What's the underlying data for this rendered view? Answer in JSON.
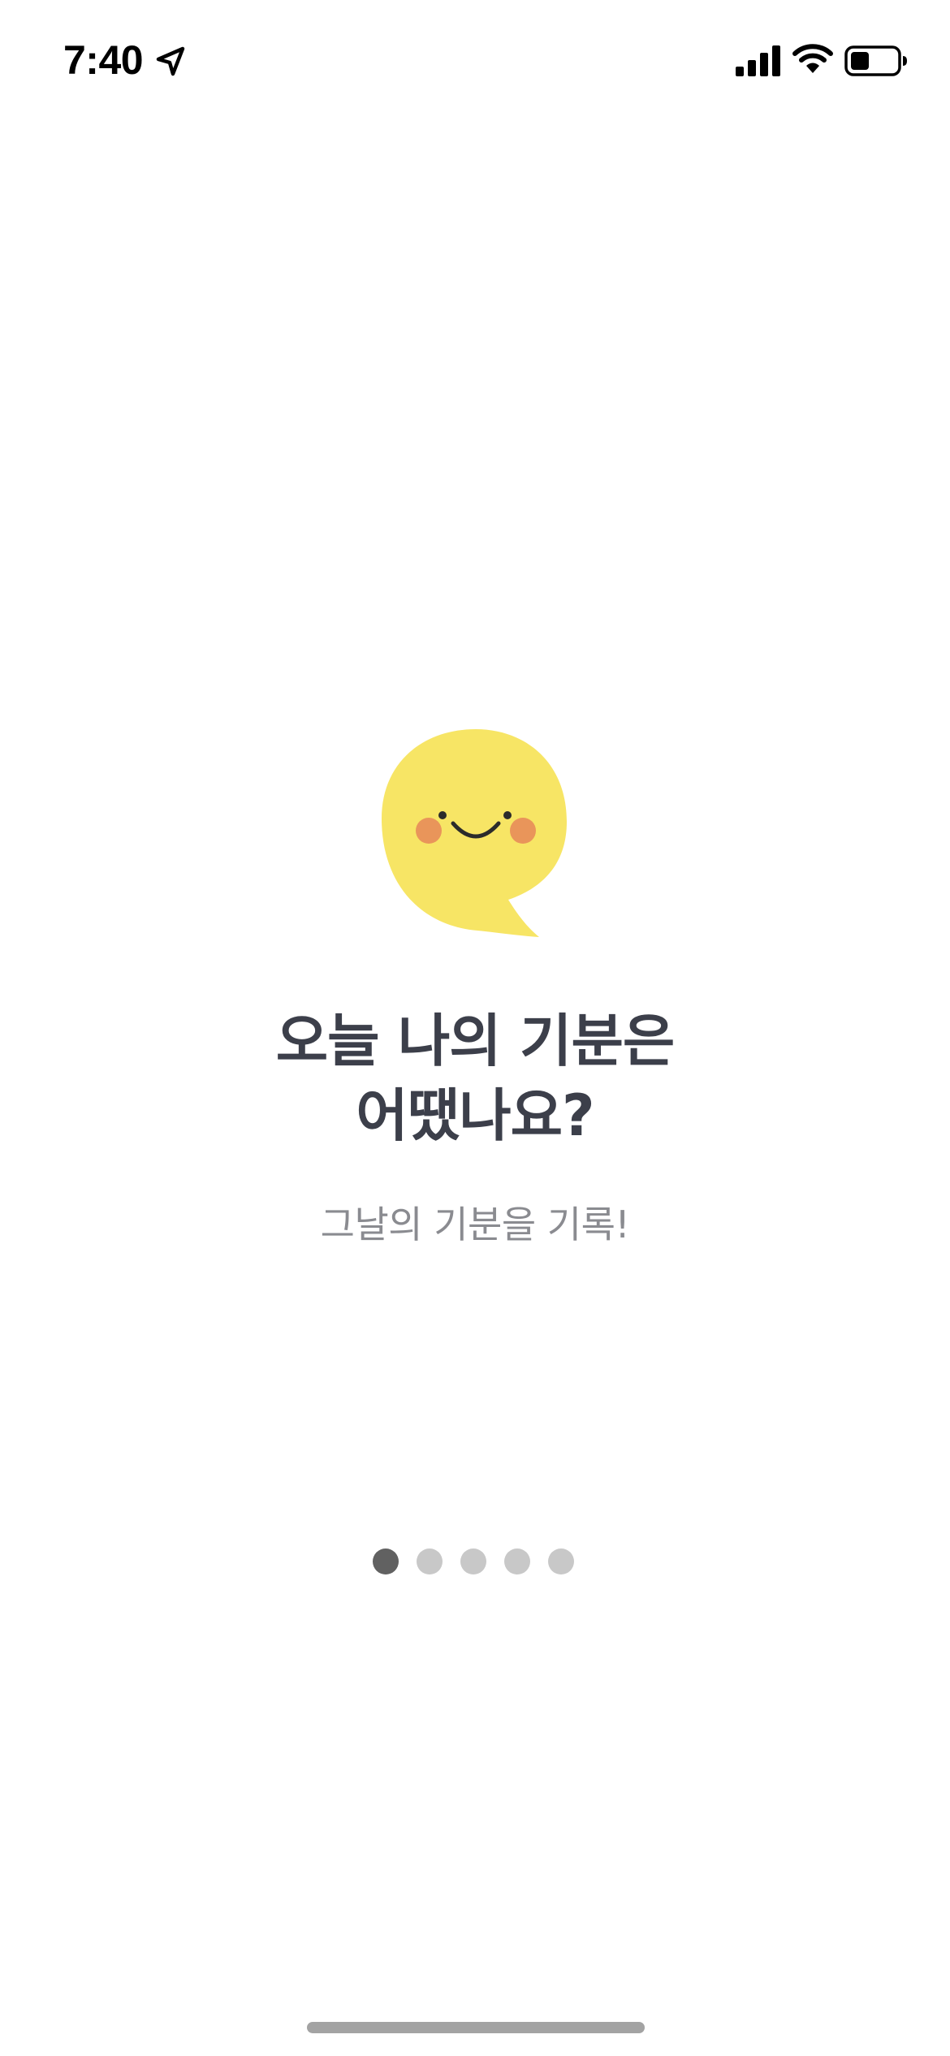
{
  "status_bar": {
    "time": "7:40",
    "icons": [
      "location-arrow-icon",
      "cellular-signal-icon",
      "wifi-icon",
      "battery-icon"
    ],
    "battery_level": 0.35
  },
  "onboarding": {
    "mascot_icon": "smiling-speech-bubble-icon",
    "title_line1": "오늘 나의 기분은",
    "title_line2": "어땠나요?",
    "subtitle": "그날의 기분을 기록!",
    "page_count": 5,
    "current_page": 1
  },
  "colors": {
    "mascot_yellow": "#f7e565",
    "mascot_cheek": "#e9955a",
    "title": "#3c3f4a",
    "subtitle": "#8a8b90",
    "dot_active": "#616161",
    "dot_inactive": "#c8c8c8"
  }
}
